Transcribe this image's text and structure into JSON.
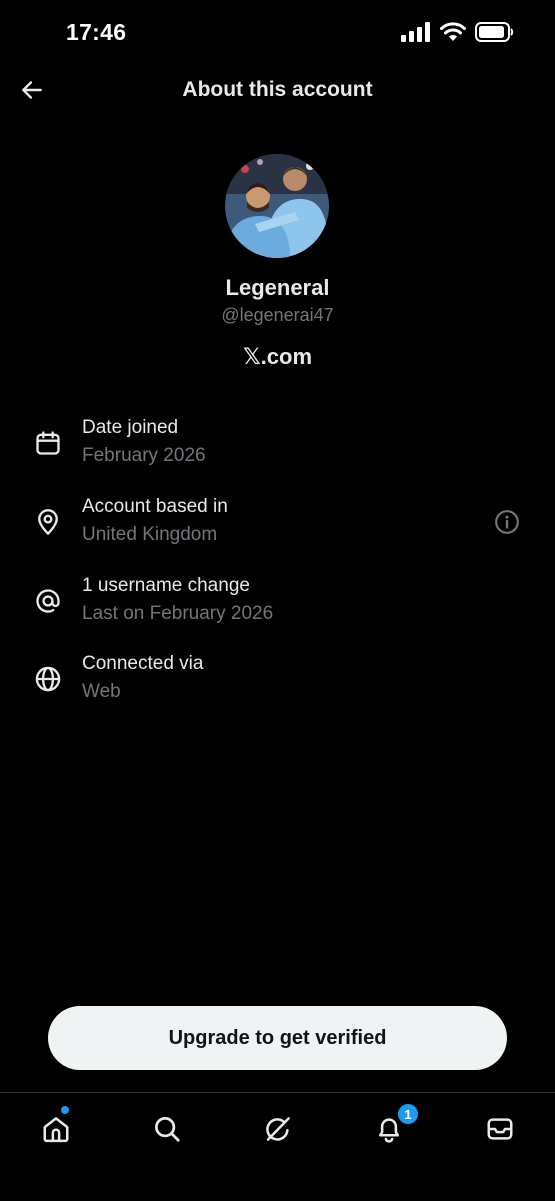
{
  "status_bar": {
    "time": "17:46"
  },
  "header": {
    "title": "About this account"
  },
  "profile": {
    "display_name": "Legeneral",
    "handle": "@legenerai47",
    "source": "𝕏.com"
  },
  "rows": [
    {
      "icon": "calendar-icon",
      "label": "Date joined",
      "value": "February 2026"
    },
    {
      "icon": "location-pin-icon",
      "label": "Account based in",
      "value": "United Kingdom"
    },
    {
      "icon": "at-sign-icon",
      "label": "1 username change",
      "value": "Last on February 2026"
    },
    {
      "icon": "globe-icon",
      "label": "Connected via",
      "value": "Web"
    }
  ],
  "cta": {
    "label": "Upgrade to get verified"
  },
  "nav": {
    "items": [
      "home-icon",
      "search-icon",
      "grok-icon",
      "notifications-icon",
      "messages-icon"
    ],
    "notification_badge": "1"
  },
  "colors": {
    "background": "#000000",
    "accent": "#1d9bf0",
    "muted": "#71767b",
    "text": "#e7e9ea"
  }
}
